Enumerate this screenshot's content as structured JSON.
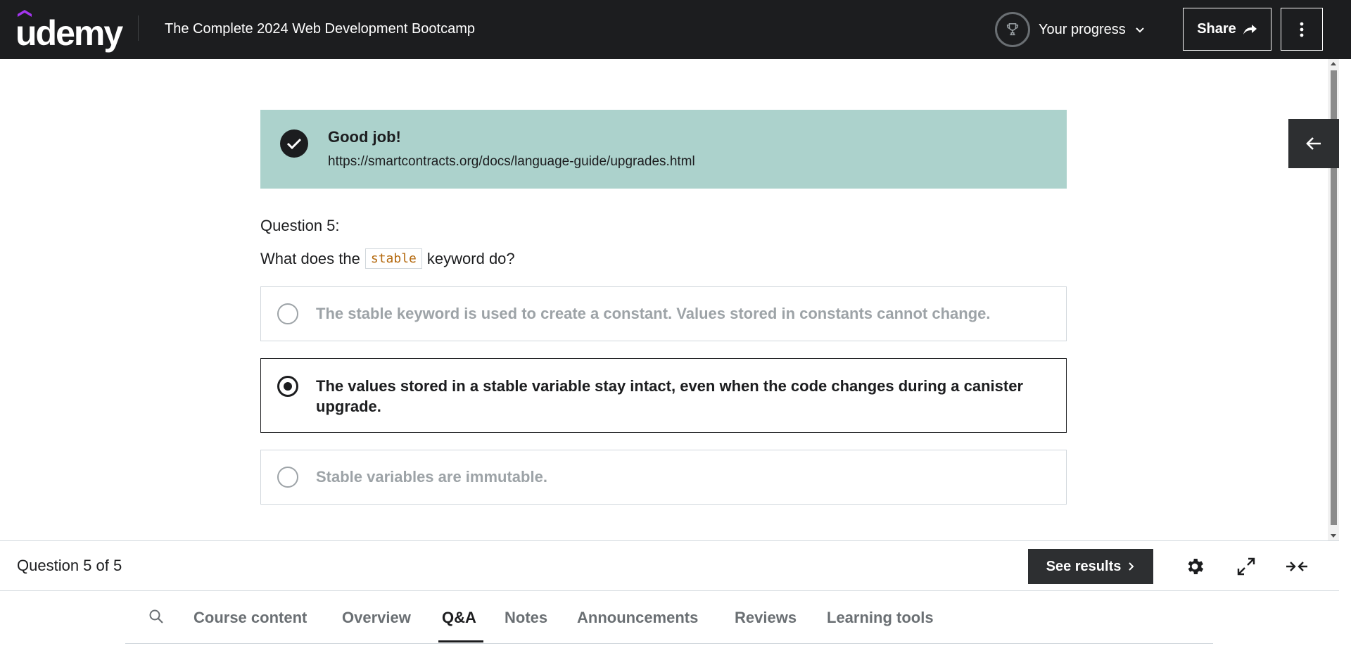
{
  "header": {
    "logo_text": "udemy",
    "course_title": "The Complete 2024 Web Development Bootcamp",
    "progress_label": "Your progress",
    "share_label": "Share"
  },
  "alert": {
    "title": "Good job!",
    "link": "https://smartcontracts.org/docs/language-guide/upgrades.html"
  },
  "question": {
    "label": "Question 5:",
    "text_before": "What does the",
    "code": "stable",
    "text_after": "keyword do?",
    "options": [
      {
        "text": "The stable keyword is used to create a constant. Values stored in constants cannot change.",
        "selected": false
      },
      {
        "text": "The values stored in a stable variable stay intact, even when the code changes during a canister upgrade.",
        "selected": true
      },
      {
        "text": "Stable variables are immutable.",
        "selected": false
      }
    ]
  },
  "bottom_bar": {
    "counter": "Question 5 of 5",
    "see_results_label": "See results"
  },
  "tabs": [
    {
      "label": "Course content",
      "active": false
    },
    {
      "label": "Overview",
      "active": false
    },
    {
      "label": "Q&A",
      "active": true
    },
    {
      "label": "Notes",
      "active": false
    },
    {
      "label": "Announcements",
      "active": false
    },
    {
      "label": "Reviews",
      "active": false
    },
    {
      "label": "Learning tools",
      "active": false
    }
  ],
  "colors": {
    "header_bg": "#1c1d1f",
    "alert_bg": "#acd2cc",
    "brand_purple": "#a435f0",
    "code_text": "#b4690e"
  },
  "icons": {
    "logo_hat": "udemy-hat-icon",
    "progress": "trophy-icon",
    "progress_toggle": "chevron-down-icon",
    "share": "share-arrow-icon",
    "menu": "more-vertical-icon",
    "sidebar": "arrow-left-icon",
    "alert": "check-circle-icon",
    "see_results": "chevron-right-icon",
    "settings": "gear-icon",
    "fullscreen": "expand-icon",
    "collapse": "collapse-icon",
    "search": "search-icon"
  }
}
